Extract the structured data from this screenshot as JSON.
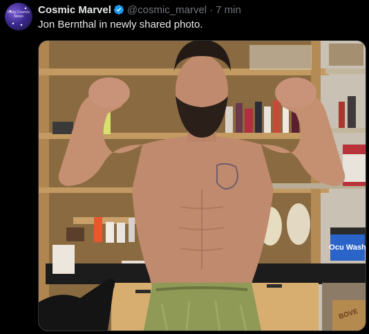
{
  "post": {
    "avatar_text": "Daily Cosmic News",
    "display_name": "Cosmic Marvel",
    "handle": "@cosmic_marvel",
    "separator": "·",
    "time": "7 min",
    "text": "Jon Bernthal in newly shared photo.",
    "verified": true
  },
  "media": {
    "product_box_text": "Ocu Wash",
    "bottom_box_text": "BOVE"
  },
  "colors": {
    "verified_blue": "#1d9bf0",
    "muted": "#71767b",
    "text": "#e7e9ea"
  }
}
